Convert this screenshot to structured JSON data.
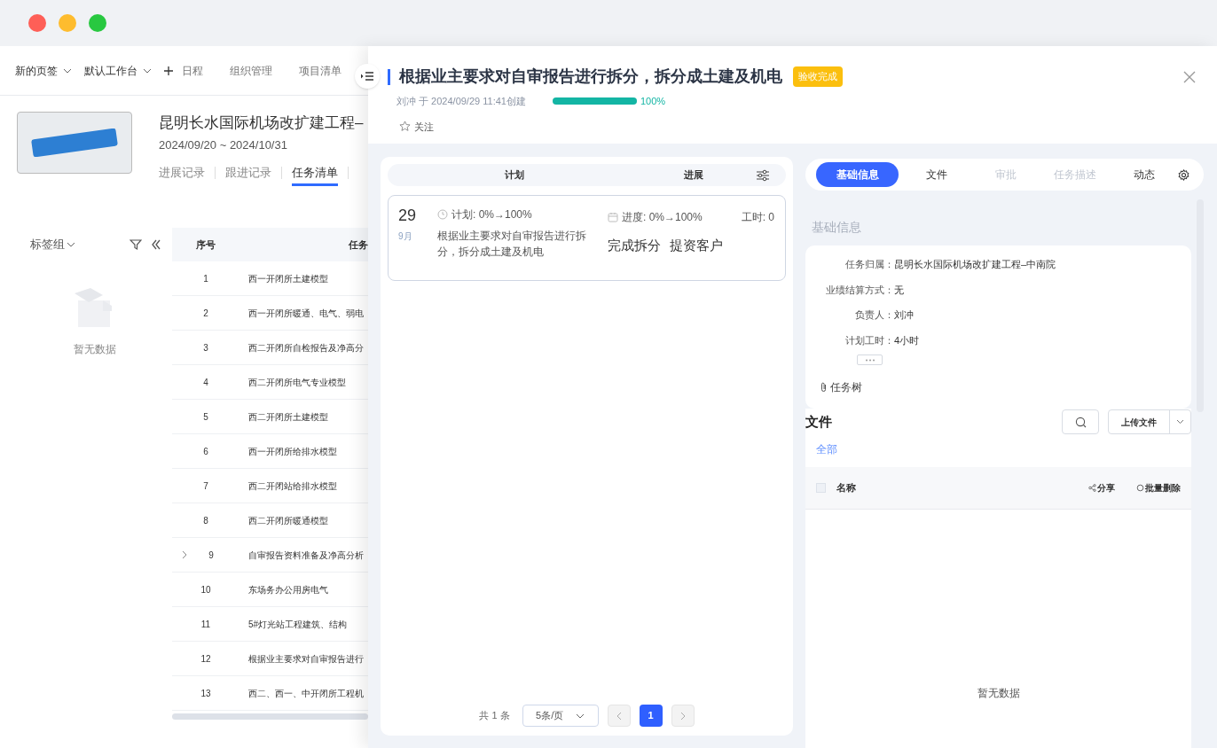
{
  "nav": [
    {
      "label": "新的页签",
      "kind": "dropdown"
    },
    {
      "label": "默认工作台",
      "kind": "dropdown"
    },
    {
      "label": "日程",
      "kind": "plus"
    },
    {
      "label": "组织管理",
      "kind": "link"
    },
    {
      "label": "项目清单",
      "kind": "link"
    }
  ],
  "project": {
    "title": "昆明长水国际机场改扩建工程–",
    "dates": "2024/09/20 ~ 2024/10/31",
    "tabs": [
      {
        "label": "进展记录",
        "selected": false
      },
      {
        "label": "跟进记录",
        "selected": false
      },
      {
        "label": "任务清单",
        "selected": true
      }
    ]
  },
  "tag_panel": {
    "label": "标签组",
    "empty_text": "暂无数据"
  },
  "task_table": {
    "columns": [
      "序号",
      "任务"
    ],
    "rows": [
      {
        "index": "1",
        "name": "西一开闭所土建模型",
        "expandable": false
      },
      {
        "index": "2",
        "name": "西一开闭所暖通、电气、弱电",
        "expandable": false
      },
      {
        "index": "3",
        "name": "西二开闭所自检报告及净高分",
        "expandable": false
      },
      {
        "index": "4",
        "name": "西二开闭所电气专业模型",
        "expandable": false
      },
      {
        "index": "5",
        "name": "西二开闭所土建模型",
        "expandable": false
      },
      {
        "index": "6",
        "name": "西一开闭所给排水模型",
        "expandable": false
      },
      {
        "index": "7",
        "name": "西二开闭站给排水模型",
        "expandable": false
      },
      {
        "index": "8",
        "name": "西二开闭所暖通模型",
        "expandable": false
      },
      {
        "index": "9",
        "name": "自审报告资料准备及净高分析",
        "expandable": true
      },
      {
        "index": "10",
        "name": "东场务办公用房电气",
        "expandable": false
      },
      {
        "index": "11",
        "name": "5#灯光站工程建筑、结构",
        "expandable": false
      },
      {
        "index": "12",
        "name": "根据业主要求对自审报告进行",
        "expandable": false
      },
      {
        "index": "13",
        "name": "西二、西一、中开闭所工程机",
        "expandable": false
      }
    ]
  },
  "drawer": {
    "title": "根据业主要求对自审报告进行拆分，拆分成土建及机电",
    "status_badge": "验收完成",
    "meta": "刘冲 于 2024/09/29 11:41创建",
    "progress": {
      "level": 1,
      "reading": "100%"
    },
    "follow_label": "关注",
    "plan_panel": {
      "columns": [
        "计划",
        "进展"
      ],
      "cards": [
        {
          "day": "29",
          "month": "9月",
          "plan": "计划: 0%→100%",
          "description": "根据业主要求对自审报告进行拆分，拆分成土建及机电",
          "progress": "进度: 0%→100%",
          "hours": "工时: 0",
          "tags": [
            "完成拆分",
            "提资客户"
          ]
        }
      ]
    },
    "pagination": {
      "total": "共 1 条",
      "page_size": "5条/页",
      "pages": [
        {
          "label": "1",
          "selected": true
        }
      ]
    },
    "detail_tabs": [
      {
        "label": "基础信息",
        "selected": true,
        "disabled": false
      },
      {
        "label": "文件",
        "selected": false,
        "disabled": false
      },
      {
        "label": "审批",
        "selected": false,
        "disabled": true
      },
      {
        "label": "任务描述",
        "selected": false,
        "disabled": true
      },
      {
        "label": "动态",
        "selected": false,
        "disabled": false
      }
    ],
    "section_title": "基础信息",
    "fields": [
      {
        "label": "任务归属：",
        "value": "昆明长水国际机场改扩建工程–中南院"
      },
      {
        "label": "业绩结算方式：",
        "value": "无"
      },
      {
        "label": "负责人：",
        "value": "刘冲"
      },
      {
        "label": "计划工时：",
        "value": "4小时"
      }
    ],
    "task_tree_label": "任务树",
    "files": {
      "title": "文件",
      "upload_label": "上传文件",
      "filter": "全部",
      "column": "名称",
      "select_all_checked": false,
      "actions": [
        "分享",
        "批量删除"
      ],
      "empty_text": "暂无数据"
    }
  }
}
